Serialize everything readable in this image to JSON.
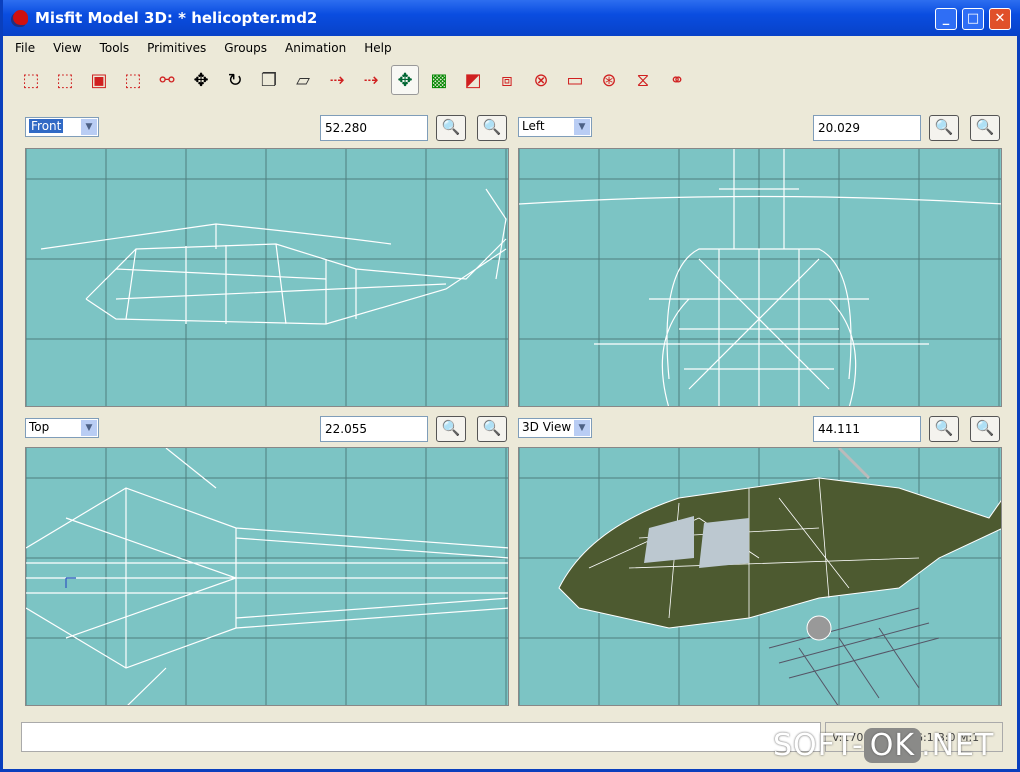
{
  "window": {
    "title": "Misfit Model 3D: * helicopter.md2",
    "minimize": "_",
    "maximize": "□",
    "close": "✕"
  },
  "menu": [
    "File",
    "View",
    "Tools",
    "Primitives",
    "Groups",
    "Animation",
    "Help"
  ],
  "toolbar": [
    "select-vertices",
    "select-faces",
    "select-groups",
    "select-connected",
    "select-bone-joints",
    "move",
    "rotate",
    "scale",
    "shear",
    "extrude",
    "attract",
    "move-background",
    "scale-background",
    "create-rectangle",
    "create-cube",
    "create-ellipsoid",
    "create-cylinder",
    "create-torus",
    "create-polygon",
    "create-bone"
  ],
  "viewports": [
    {
      "view": "Front",
      "zoom": "52.280"
    },
    {
      "view": "Left",
      "zoom": "20.029"
    },
    {
      "view": "Top",
      "zoom": "22.055"
    },
    {
      "view": "3D View",
      "zoom": "44.111"
    }
  ],
  "zoom_in_icon": "zoom-in-icon",
  "zoom_out_icon": "zoom-out-icon",
  "status": {
    "message": "",
    "counts": "V:1708 F:1317 G:1 B:0 M:1"
  },
  "watermark": "SOFT-OK.NET",
  "colors": {
    "viewport_bg": "#7cc4c4",
    "title_bar": "#0a4de0",
    "wireframe": "#ffffff"
  }
}
